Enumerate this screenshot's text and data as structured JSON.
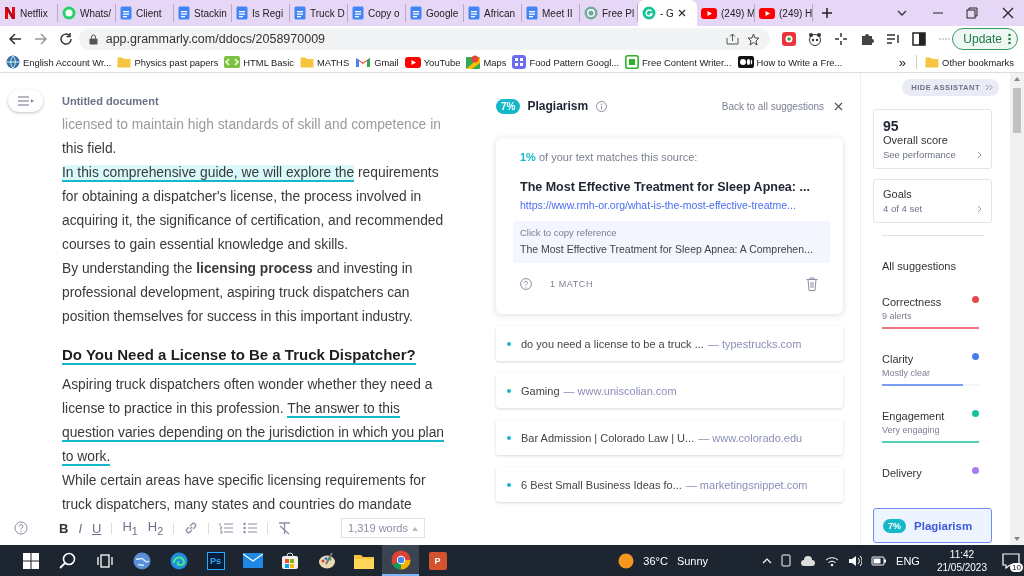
{
  "tabs": [
    {
      "kind": "netflix",
      "title": "Netflix",
      "selected": false
    },
    {
      "kind": "whatsapp",
      "title": "Whats/",
      "selected": false
    },
    {
      "kind": "docs",
      "title": "Client",
      "selected": false
    },
    {
      "kind": "docs",
      "title": "Stackin",
      "selected": false
    },
    {
      "kind": "docs",
      "title": "Is Regi",
      "selected": false
    },
    {
      "kind": "docs",
      "title": "Truck D",
      "selected": false
    },
    {
      "kind": "docs",
      "title": "Copy o",
      "selected": false
    },
    {
      "kind": "docs",
      "title": "Google",
      "selected": false
    },
    {
      "kind": "docs",
      "title": "African",
      "selected": false
    },
    {
      "kind": "docs",
      "title": "Meet II",
      "selected": false
    },
    {
      "kind": "openai",
      "title": "Free Pl",
      "selected": false
    },
    {
      "kind": "grammarly",
      "title": "- G",
      "selected": true
    },
    {
      "kind": "youtube",
      "title": "(249) M",
      "selected": false
    },
    {
      "kind": "youtube",
      "title": "(249) H",
      "selected": false
    }
  ],
  "address": {
    "url": "app.grammarly.com/ddocs/2058970009",
    "update_button": "Update"
  },
  "bookmarks": [
    {
      "kind": "globe",
      "label": "English Account Wr..."
    },
    {
      "kind": "folder",
      "label": "Physics past papers"
    },
    {
      "kind": "html",
      "label": "HTML Basic"
    },
    {
      "kind": "folder",
      "label": "MATHS"
    },
    {
      "kind": "gmail",
      "label": "Gmail"
    },
    {
      "kind": "youtube",
      "label": "YouTube"
    },
    {
      "kind": "maps",
      "label": "Maps"
    },
    {
      "kind": "app",
      "label": "Food Pattern Googl..."
    },
    {
      "kind": "content",
      "label": "Free Content Writer..."
    },
    {
      "kind": "medium",
      "label": "How to Write a Fre..."
    },
    {
      "kind": "more",
      "label": "»"
    },
    {
      "kind": "folder",
      "label": "Other bookmarks"
    }
  ],
  "document": {
    "title": "Untitled document",
    "lines": [
      {
        "kind": "faded",
        "segments": [
          {
            "kind": "plain",
            "text": "licensed to maintain high standards of skill and competence in"
          }
        ]
      },
      {
        "kind": "text",
        "segments": [
          {
            "kind": "plain",
            "text": "this field."
          }
        ]
      },
      {
        "kind": "text",
        "segments": [
          {
            "kind": "highlight",
            "text": "In this comprehensive guide, we will explore the"
          },
          {
            "kind": "plain",
            "text": " requirements"
          }
        ]
      },
      {
        "kind": "text",
        "segments": [
          {
            "kind": "plain",
            "text": "for obtaining a dispatcher's license, the process involved in"
          }
        ]
      },
      {
        "kind": "text",
        "segments": [
          {
            "kind": "plain",
            "text": "acquiring it, the significance of certification, and recommended"
          }
        ]
      },
      {
        "kind": "text",
        "segments": [
          {
            "kind": "plain",
            "text": "courses to gain essential knowledge and skills."
          }
        ]
      },
      {
        "kind": "text",
        "segments": [
          {
            "kind": "plain",
            "text": "By understanding the **licensing process** and investing in"
          }
        ]
      },
      {
        "kind": "text",
        "segments": [
          {
            "kind": "plain",
            "text": "professional development, aspiring truck dispatchers can"
          }
        ]
      },
      {
        "kind": "text",
        "segments": [
          {
            "kind": "plain",
            "text": "position themselves for success in this important industry."
          }
        ]
      },
      {
        "kind": "heading",
        "segments": [
          {
            "kind": "underline",
            "text": "Do You Need a License to Be a Truck Dispatcher?"
          }
        ]
      },
      {
        "kind": "text",
        "segments": [
          {
            "kind": "plain",
            "text": "Aspiring truck dispatchers often wonder whether they need a"
          }
        ]
      },
      {
        "kind": "text",
        "segments": [
          {
            "kind": "plain",
            "text": "license to practice in this profession. "
          },
          {
            "kind": "underline",
            "text": "The answer to this"
          }
        ]
      },
      {
        "kind": "text",
        "segments": [
          {
            "kind": "underline",
            "text": "question varies depending on "
          },
          {
            "kind": "underline",
            "text": "the jurisdiction in which you plan"
          }
        ]
      },
      {
        "kind": "text",
        "segments": [
          {
            "kind": "underline",
            "text": "to work."
          }
        ]
      },
      {
        "kind": "text",
        "segments": [
          {
            "kind": "plain",
            "text": "While certain areas have specific licensing requirements for"
          }
        ]
      },
      {
        "kind": "text",
        "segments": [
          {
            "kind": "plain",
            "text": "truck dispatchers, many states and countries do mandate"
          }
        ]
      }
    ],
    "toolbar": {
      "format_buttons": [
        "B",
        "I",
        "U",
        "H$_{1}$",
        "H$_{2}$"
      ],
      "word_count": "1,319 words"
    }
  },
  "plagiarism": {
    "percent": "7%",
    "title": "Plagiarism",
    "back_link": "Back to all suggestions",
    "match_card": {
      "percent": "1%",
      "text": " of your text matches this source:",
      "source_title": "The Most Effective Treatment for Sleep Apnea: ...",
      "url": "https://www.rmh-or.org/what-is-the-most-effective-treatme...",
      "reference_label": "Click to copy reference",
      "reference": "The Most Effective Treatment for Sleep Apnea: A Comprehen...",
      "matches": "1 MATCH"
    },
    "sources": [
      {
        "title": "do you need a license to be a truck ...",
        "domain": "— typestrucks.com"
      },
      {
        "title": "Gaming",
        "domain": "— www.uniscolian.com"
      },
      {
        "title": "Bar Admission | Colorado Law | U...",
        "domain": "— www.colorado.edu"
      },
      {
        "title": "6 Best Small Business Ideas fo...",
        "domain": "— marketingsnippet.com"
      }
    ]
  },
  "sidebar": {
    "hide_button": "HIDE ASSISTANT",
    "score": "95",
    "score_label": "Overall score",
    "score_link": "See performance",
    "goals_title": "Goals",
    "goals_value": "4 of 4 set",
    "suggestions_heading": "All suggestions",
    "categories": [
      {
        "name": "Correctness",
        "status": "9 alerts",
        "color": "#e5484d",
        "level": 1
      },
      {
        "name": "Clarity",
        "status": "Mostly clear",
        "color": "#4a7cf0",
        "level": 0.83
      },
      {
        "name": "Engagement",
        "status": "Very engaging",
        "color": "#15c39a",
        "level": 1
      },
      {
        "name": "Delivery",
        "color": "#a67cf2"
      }
    ],
    "plagiarism_button": {
      "percent": "7%",
      "label": "Plagiarism",
      "selected": true
    }
  },
  "taskbar": {
    "apps": [
      {
        "kind": "globe",
        "selected": false
      },
      {
        "kind": "edge",
        "selected": false
      },
      {
        "kind": "photoshop",
        "label": "Ps",
        "selected": false
      },
      {
        "kind": "mail",
        "selected": false
      },
      {
        "kind": "store",
        "selected": false
      },
      {
        "kind": "paint",
        "selected": false
      },
      {
        "kind": "folder",
        "selected": false
      },
      {
        "kind": "chrome",
        "selected": true
      },
      {
        "kind": "powerpoint",
        "label": "P",
        "selected": false
      }
    ],
    "temperature": "36°C",
    "weather": "Sunny",
    "language": "ENG",
    "time": "11:42",
    "date": "21/05/2023",
    "notifications": "10"
  }
}
